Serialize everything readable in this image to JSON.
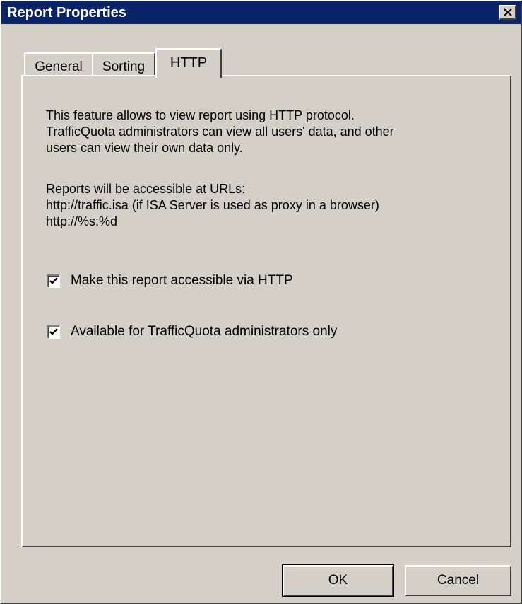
{
  "window": {
    "title": "Report Properties"
  },
  "tabs": [
    {
      "label": "General",
      "active": false
    },
    {
      "label": "Sorting",
      "active": false
    },
    {
      "label": "HTTP",
      "active": true
    }
  ],
  "http": {
    "description_lines": [
      "This feature allows to view report using HTTP protocol.",
      "TrafficQuota administrators can view all users' data, and other",
      "users can view their own data only."
    ],
    "urls_lines": [
      "Reports will be accessible at URLs:",
      "http://traffic.isa (if ISA Server is used as proxy in a browser)",
      "http://%s:%d"
    ],
    "options": [
      {
        "label": "Make this report accessible via HTTP",
        "checked": true
      },
      {
        "label": "Available for TrafficQuota administrators only",
        "checked": true
      }
    ]
  },
  "buttons": {
    "ok": "OK",
    "cancel": "Cancel"
  },
  "icons": {
    "close": "close-icon",
    "check": "checkmark-icon"
  },
  "colors": {
    "titlebar": "#0a246a",
    "dialog": "#d4d0c8"
  }
}
